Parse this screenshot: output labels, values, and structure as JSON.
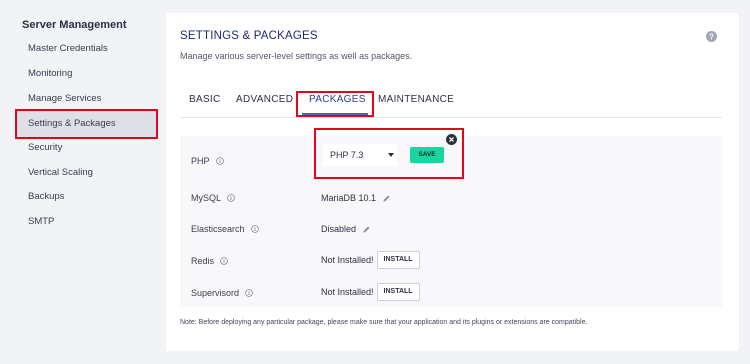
{
  "sidebar": {
    "title": "Server Management",
    "items": [
      {
        "label": "Master Credentials"
      },
      {
        "label": "Monitoring"
      },
      {
        "label": "Manage Services"
      },
      {
        "label": "Settings & Packages",
        "active": true
      },
      {
        "label": "Security"
      },
      {
        "label": "Vertical Scaling"
      },
      {
        "label": "Backups"
      },
      {
        "label": "SMTP"
      }
    ]
  },
  "card": {
    "title": "SETTINGS & PACKAGES",
    "subtitle": "Manage various server-level settings as well as packages.",
    "help_icon": "question-circle-icon"
  },
  "tabs": [
    {
      "label": "BASIC"
    },
    {
      "label": "ADVANCED"
    },
    {
      "label": "PACKAGES",
      "active": true
    },
    {
      "label": "MAINTENANCE"
    }
  ],
  "packages": {
    "php": {
      "label": "PHP",
      "selected": "PHP 7.3",
      "save_label": "SAVE"
    },
    "mysql": {
      "label": "MySQL",
      "value": "MariaDB 10.1"
    },
    "elasticsearch": {
      "label": "Elasticsearch",
      "value": "Disabled"
    },
    "redis": {
      "label": "Redis",
      "value": "Not Installed!",
      "action": "INSTALL"
    },
    "supervisord": {
      "label": "Supervisord",
      "value": "Not Installed!",
      "action": "INSTALL"
    }
  },
  "note": "Note: Before deploying any particular package, please make sure that your application and its plugins or extensions are compatible.",
  "colors": {
    "highlight": "#e3061b",
    "accent": "#2b3d90",
    "save_button": "#18d6a0"
  }
}
